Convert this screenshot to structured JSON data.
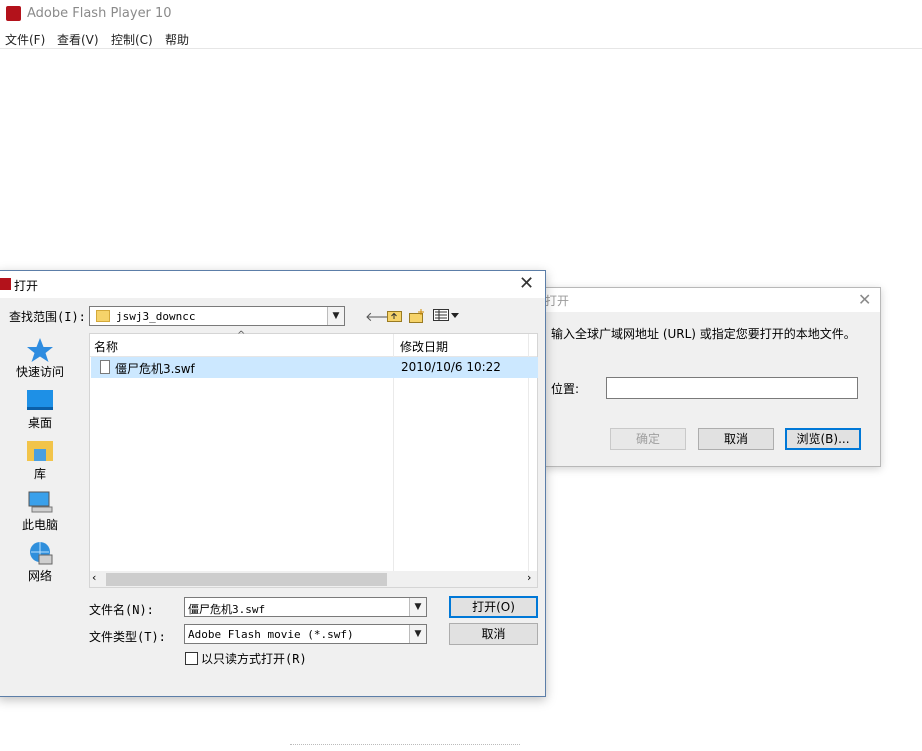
{
  "app": {
    "title": "Adobe Flash Player 10",
    "menu": [
      "文件(F)",
      "查看(V)",
      "控制(C)",
      "帮助"
    ]
  },
  "open_location_dialog": {
    "title": "打开",
    "message": "输入全球广域网地址 (URL) 或指定您要打开的本地文件。",
    "location_label": "位置:",
    "location_value": "",
    "ok_label": "确定",
    "cancel_label": "取消",
    "browse_label": "浏览(B)..."
  },
  "open_file_dialog": {
    "title": "打开",
    "look_in_label": "查找范围(I):",
    "look_in_value": "jswj3_downcc",
    "places": [
      "快速访问",
      "桌面",
      "库",
      "此电脑",
      "网络"
    ],
    "columns": {
      "name": "名称",
      "date": "修改日期"
    },
    "files": [
      {
        "name": "僵尸危机3.swf",
        "date": "2010/10/6 10:22"
      }
    ],
    "file_name_label": "文件名(N):",
    "file_name_value": "僵尸危机3.swf",
    "file_type_label": "文件类型(T):",
    "file_type_value": "Adobe Flash movie (*.swf)",
    "open_label": "打开(O)",
    "cancel_label": "取消",
    "readonly_label": "以只读方式打开(R)",
    "readonly_checked": false
  },
  "colors": {
    "flash_red": "#b3121b",
    "selection": "#cce8ff",
    "dialog_bg": "#f0f0f0",
    "accent_blue": "#0078d7"
  }
}
